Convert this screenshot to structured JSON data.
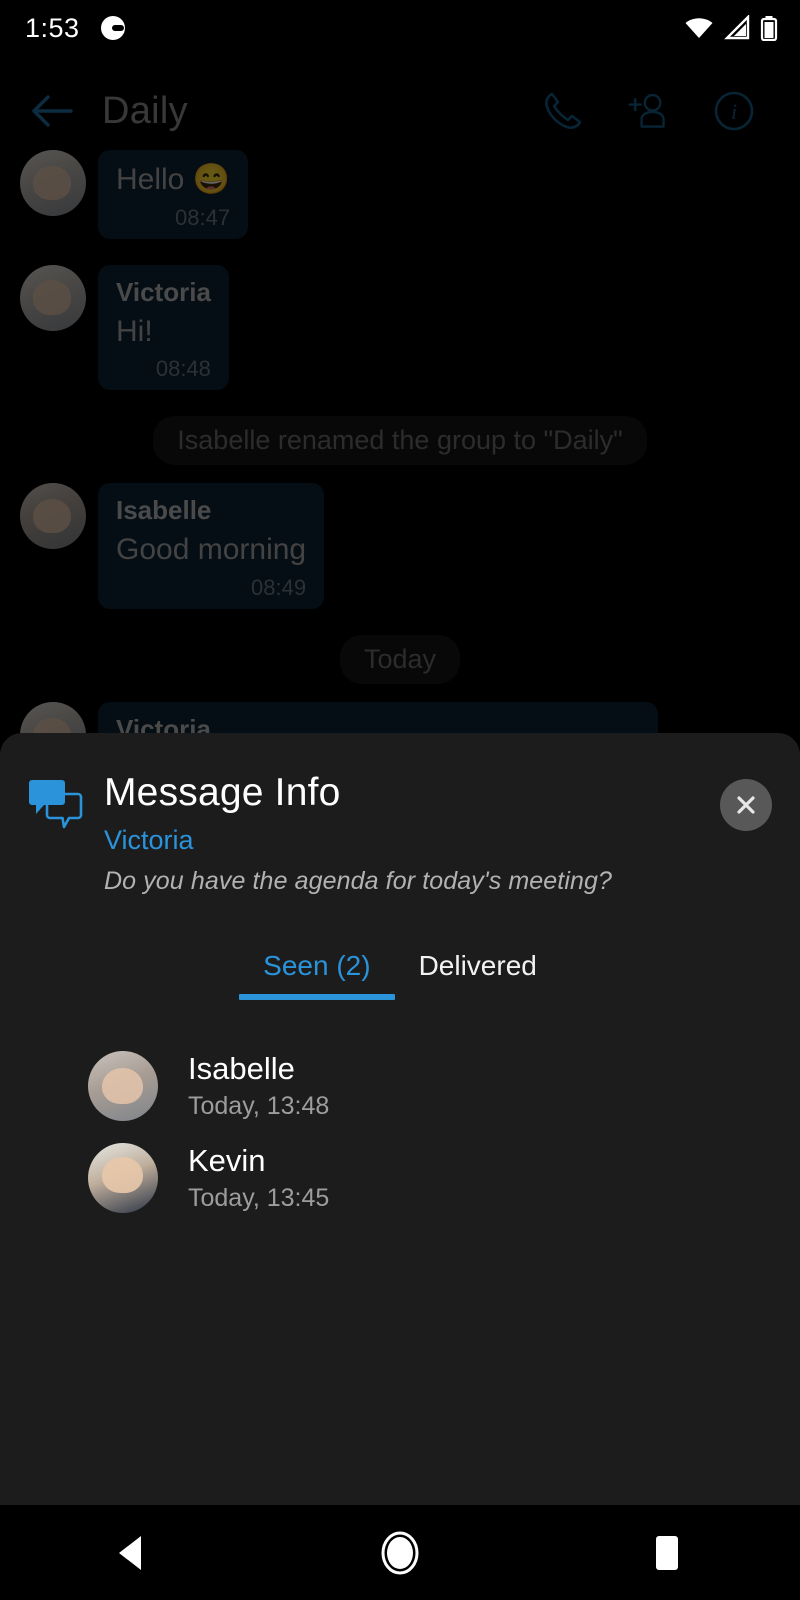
{
  "status_bar": {
    "time": "1:53",
    "app_icon": "app-notification-icon",
    "icons": [
      "wifi-icon",
      "cellular-signal-icon",
      "battery-icon"
    ]
  },
  "chat_header": {
    "back_icon": "back-arrow-icon",
    "title": "Daily",
    "actions": [
      {
        "name": "call-icon",
        "label": "Call"
      },
      {
        "name": "add-person-icon",
        "label": "Add participant"
      },
      {
        "name": "info-icon",
        "label": "Info"
      }
    ]
  },
  "chat": {
    "messages": [
      {
        "type": "message",
        "sender": "",
        "text": "Hello 😄",
        "time": "08:47",
        "avatar": "v"
      },
      {
        "type": "message",
        "sender": "Victoria",
        "text": "Hi!",
        "time": "08:48",
        "avatar": "v"
      },
      {
        "type": "system",
        "text": "Isabelle renamed the group to \"Daily\""
      },
      {
        "type": "message",
        "sender": "Isabelle",
        "text": "Good morning",
        "time": "08:49",
        "avatar": "i"
      },
      {
        "type": "system",
        "text": "Today"
      },
      {
        "type": "message",
        "sender": "Victoria",
        "text": "",
        "time": "",
        "avatar": "v"
      }
    ]
  },
  "modal": {
    "icon": "message-info-icon",
    "title": "Message Info",
    "sender": "Victoria",
    "preview": "Do you have the agenda for today's meeting?",
    "close_icon": "close-icon",
    "tabs": [
      {
        "label": "Seen (2)",
        "active": true
      },
      {
        "label": "Delivered",
        "active": false
      }
    ],
    "people": [
      {
        "name": "Isabelle",
        "time": "Today, 13:48",
        "avatar": "i"
      },
      {
        "name": "Kevin",
        "time": "Today, 13:45",
        "avatar": "k"
      }
    ]
  },
  "nav_bar": {
    "back": "nav-back-icon",
    "home": "nav-home-icon",
    "recents": "nav-recents-icon"
  },
  "colors": {
    "accent": "#2a93da",
    "sheet_bg": "#1c1c1c",
    "bubble_bg": "#0e2434",
    "screen_bg": "#000000"
  }
}
